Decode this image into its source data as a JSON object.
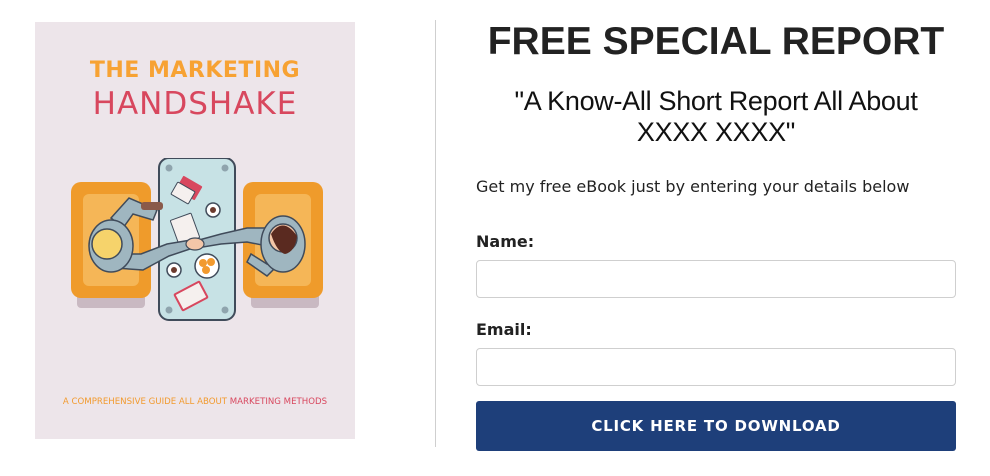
{
  "cover": {
    "title_line1": "THE MARKETING",
    "title_line2": "HANDSHAKE",
    "subtitle_prefix": "A COMPREHENSIVE GUIDE ALL ABOUT ",
    "subtitle_highlight": "MARKETING METHODS",
    "colors": {
      "background": "#ede5ea",
      "orange": "#f7a233",
      "red": "#d8475e"
    }
  },
  "form": {
    "headline": "FREE SPECIAL REPORT",
    "subheadline": "\"A Know-All Short Report All About XXXX XXXX\"",
    "intro": "Get my free eBook just by entering your details below",
    "name_label": "Name:",
    "name_value": "",
    "email_label": "Email:",
    "email_value": "",
    "submit_label": "CLICK HERE TO DOWNLOAD",
    "colors": {
      "button": "#1e3f7a"
    }
  }
}
